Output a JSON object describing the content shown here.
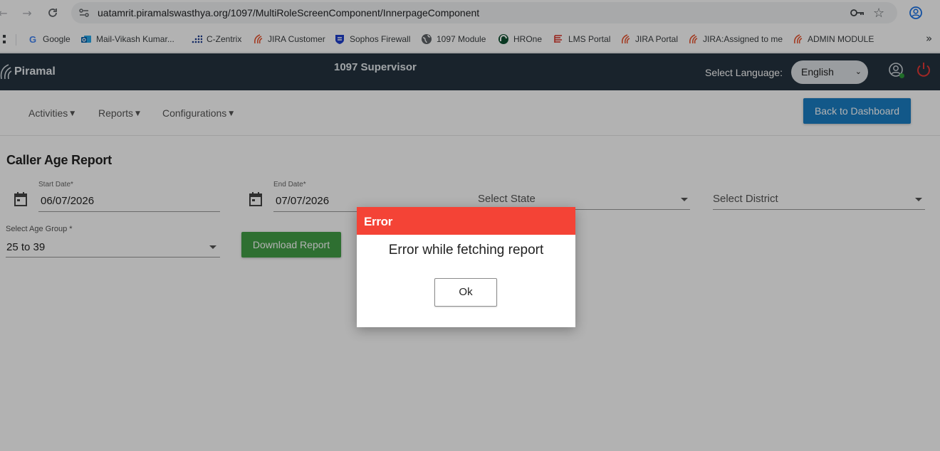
{
  "browser": {
    "url": "uatamrit.piramalswasthya.org/1097/MultiRoleScreenComponent/InnerpageComponent",
    "bookmarks": [
      {
        "label": "Google",
        "icon": "google-icon"
      },
      {
        "label": "Mail-Vikash Kumar...",
        "icon": "outlook-icon"
      },
      {
        "label": "C-Zentrix",
        "icon": "czentrix-icon"
      },
      {
        "label": "JIRA Customer",
        "icon": "piramal-icon"
      },
      {
        "label": "Sophos Firewall",
        "icon": "sophos-icon"
      },
      {
        "label": "1097 Module",
        "icon": "globe-icon"
      },
      {
        "label": "HROne",
        "icon": "hrone-icon"
      },
      {
        "label": "LMS Portal",
        "icon": "lms-icon"
      },
      {
        "label": "JIRA Portal",
        "icon": "piramal-icon"
      },
      {
        "label": "JIRA:Assigned to me",
        "icon": "piramal-icon"
      },
      {
        "label": "ADMIN MODULE",
        "icon": "piramal-icon"
      }
    ],
    "more_label": "»"
  },
  "app": {
    "logo_text": "Piramal",
    "title": "1097 Supervisor",
    "language_label": "Select Language:",
    "language_value": "English",
    "header_color": "#25333f"
  },
  "toolbar": {
    "menus": [
      "Activities",
      "Reports",
      "Configurations"
    ],
    "back_label": "Back to Dashboard"
  },
  "report": {
    "title": "Caller Age Report",
    "start_date_label": "Start Date*",
    "start_date_value": "06/07/2026",
    "end_date_label": "End Date*",
    "end_date_value": "07/07/2026",
    "state_placeholder": "Select State",
    "district_placeholder": "Select District",
    "age_group_label": "Select Age Group *",
    "age_group_value": "25 to 39",
    "download_label": "Download Report"
  },
  "dialog": {
    "header": "Error",
    "message": "Error while fetching report",
    "ok_label": "Ok",
    "header_color": "#f44336"
  }
}
